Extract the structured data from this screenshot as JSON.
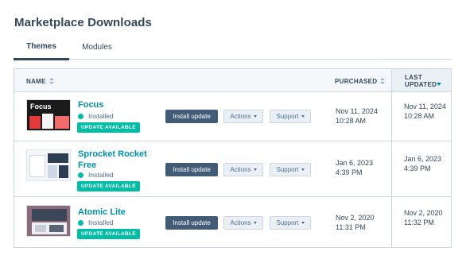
{
  "page": {
    "title": "Marketplace Downloads"
  },
  "tabs": [
    {
      "label": "Themes",
      "active": true
    },
    {
      "label": "Modules",
      "active": false
    }
  ],
  "table": {
    "columns": {
      "name": "NAME",
      "purchased": "PURCHASED",
      "last_updated": "LAST UPDATED"
    },
    "sort": {
      "column": "last_updated",
      "direction": "descending"
    },
    "rows": [
      {
        "name": "Focus",
        "thumb_text": "Focus",
        "status": "Installed",
        "badge": "UPDATE AVAILABLE",
        "install_label": "Install update",
        "actions_label": "Actions",
        "support_label": "Support",
        "purchased": "Nov 11, 2024 10:28 AM",
        "updated": "Nov 11, 2024 10:28 AM"
      },
      {
        "name": "Sprocket Rocket Free",
        "status": "Installed",
        "badge": "UPDATE AVAILABLE",
        "install_label": "Install update",
        "actions_label": "Actions",
        "support_label": "Support",
        "purchased": "Jan 6, 2023 4:39 PM",
        "updated": "Jan 6, 2023 4:39 PM"
      },
      {
        "name": "Atomic Lite",
        "status": "Installed",
        "badge": "UPDATE AVAILABLE",
        "install_label": "Install update",
        "actions_label": "Actions",
        "support_label": "Support",
        "purchased": "Nov 2, 2020 11:31 PM",
        "updated": "Nov 2, 2020 11:32 PM"
      }
    ]
  },
  "colors": {
    "accent": "#0091ae",
    "status": "#00bda5",
    "primary_button": "#425b76",
    "text": "#33475b"
  }
}
